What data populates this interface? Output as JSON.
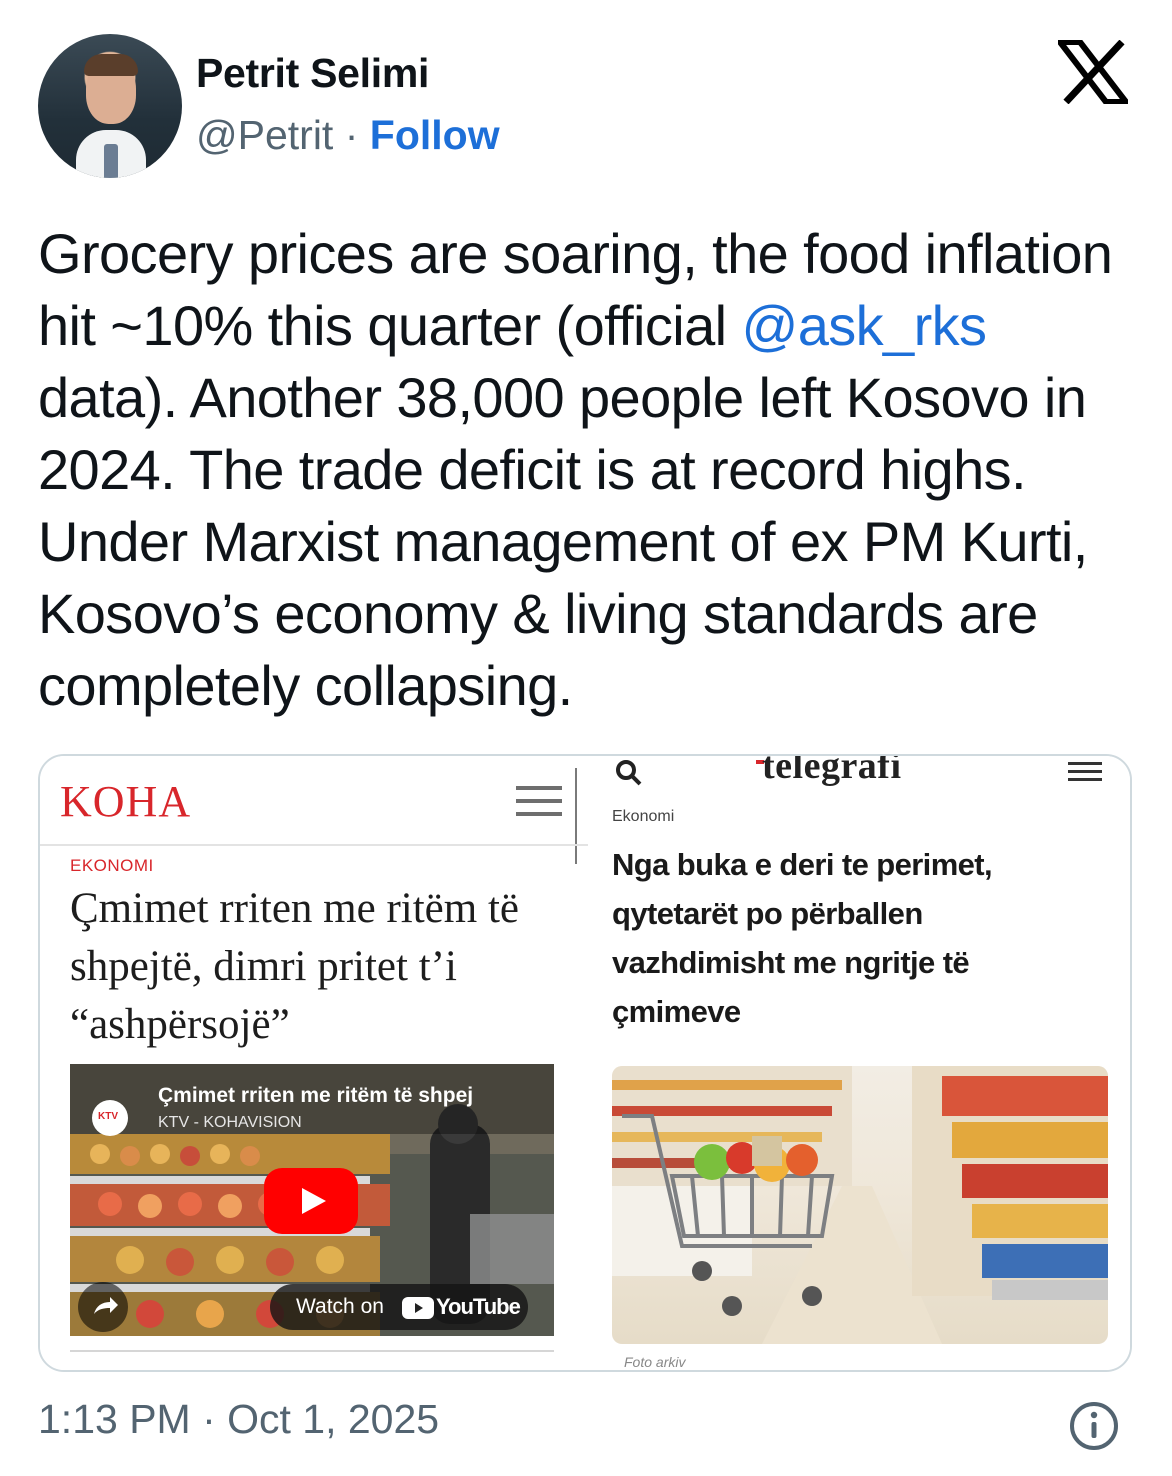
{
  "author": {
    "name": "Petrit Selimi",
    "handle": "@Petrit",
    "separator": "·",
    "follow_label": "Follow"
  },
  "tweet": {
    "text_part1": "Grocery prices are soaring, the food inflation hit ~10% this quarter (official ",
    "mention": "@ask_rks",
    "text_part2": " data). Another 38,000 people left Kosovo in 2024. The trade deficit is at record highs. Under Marxist management of ex PM Kurti, Kosovo’s economy & living standards are completely collapsing."
  },
  "media": {
    "left": {
      "logo": "KOHA",
      "category": "EKONOMI",
      "headline": "Çmimet rriten me ritëm të shpejtë, dimri pritet t’i “ashpërsojë”",
      "video": {
        "channel_badge": "KTV",
        "title": "Çmimet rriten me ritëm të shpej",
        "channel": "KTV - KOHAVISION",
        "watch_on": "Watch on",
        "youtube": "YouTube"
      }
    },
    "right": {
      "logo": "telegrafi",
      "category": "Ekonomi",
      "headline": "Nga buka e deri te perimet, qytetarët po përballen vazhdimisht me ngritje të çmimeve",
      "caption": "Foto arkiv"
    }
  },
  "footer": {
    "timestamp": "1:13 PM · Oct 1, 2025"
  },
  "colors": {
    "link": "#1d6fd8",
    "koha_red": "#d8262b",
    "youtube_red": "#ff0000"
  }
}
